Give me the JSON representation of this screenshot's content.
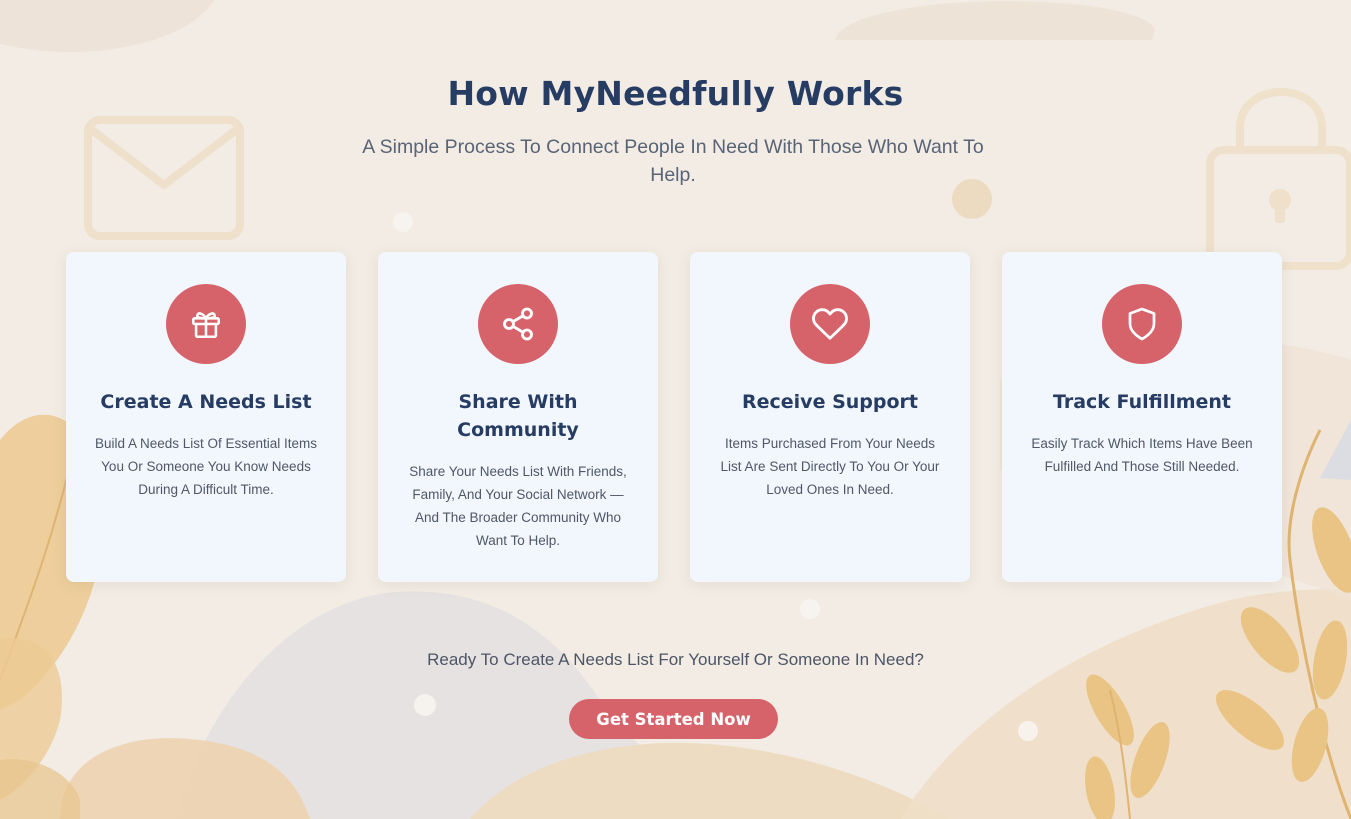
{
  "header": {
    "title": "How MyNeedfully Works",
    "subtitle": "A Simple Process To Connect People In Need With Those Who Want To Help."
  },
  "steps": [
    {
      "icon": "gift-icon",
      "title": "Create A Needs List",
      "text": "Build A Needs List Of Essential Items You Or Someone You Know Needs During A Difficult Time."
    },
    {
      "icon": "share-icon",
      "title": "Share With Community",
      "text": "Share Your Needs List With Friends, Family, And Your Social Network — And The Broader Community Who Want To Help."
    },
    {
      "icon": "heart-icon",
      "title": "Receive Support",
      "text": "Items Purchased From Your Needs List Are Sent Directly To You Or Your Loved Ones In Need."
    },
    {
      "icon": "shield-icon",
      "title": "Track Fulfillment",
      "text": "Easily Track Which Items Have Been Fulfilled And Those Still Needed."
    }
  ],
  "cta": {
    "prompt": "Ready To Create A Needs List For Yourself Or Someone In Need?",
    "button_label": "Get Started Now"
  },
  "colors": {
    "accent": "#d6636a",
    "heading": "#263c63",
    "card_background": "#f2f6fd",
    "page_background": "#f2ece4"
  }
}
